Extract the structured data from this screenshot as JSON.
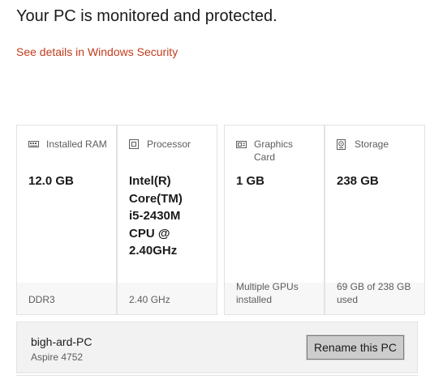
{
  "status": {
    "headline": "Your PC is monitored and protected.",
    "details_link": "See details in Windows Security"
  },
  "specs": [
    {
      "icon": "ram-icon",
      "label": "Installed RAM",
      "value": "12.0 GB",
      "detail": "DDR3"
    },
    {
      "icon": "processor-icon",
      "label": "Processor",
      "value": "Intel(R)\nCore(TM)\ni5-2430M\nCPU @\n2.40GHz",
      "detail": "2.40 GHz"
    },
    {
      "icon": "graphics-card-icon",
      "label": "Graphics\nCard",
      "value": "1 GB",
      "detail": "Multiple GPUs\ninstalled"
    },
    {
      "icon": "storage-icon",
      "label": "Storage",
      "value": "238 GB",
      "detail": "69 GB of 238 GB\nused"
    }
  ],
  "pc": {
    "name": "bigh-ard-PC",
    "model": "Aspire 4752",
    "rename_label": "Rename this PC"
  }
}
